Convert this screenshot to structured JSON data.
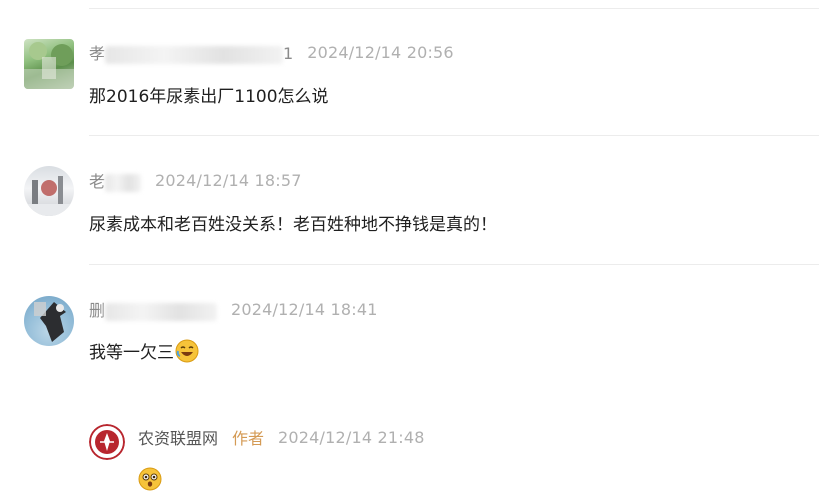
{
  "comments": [
    {
      "nickname_visible_start": "孝",
      "nickname_visible_end": "1",
      "time": "2024/12/14 20:56",
      "content": "那2016年尿素出厂1100怎么说",
      "avatar_icon": "landscape-photo-avatar"
    },
    {
      "nickname_visible_start": "老",
      "time": "2024/12/14 18:57",
      "content": "尿素成本和老百姓没关系！老百姓种地不挣钱是真的！",
      "avatar_icon": "snow-photo-avatar"
    },
    {
      "nickname_visible_start": "删",
      "time": "2024/12/14 18:41",
      "content": "我等一欠三",
      "emoji_icon": "laughing-face-emoji",
      "avatar_icon": "eagle-photo-avatar"
    }
  ],
  "reply": {
    "author": "农资联盟网",
    "author_tag": "作者",
    "time": "2024/12/14 21:48",
    "emoji_icon": "shocked-face-emoji",
    "avatar_icon": "red-seal-logo-avatar",
    "colors": {
      "tag": "#d49a54",
      "seal": "#b8262e"
    }
  }
}
